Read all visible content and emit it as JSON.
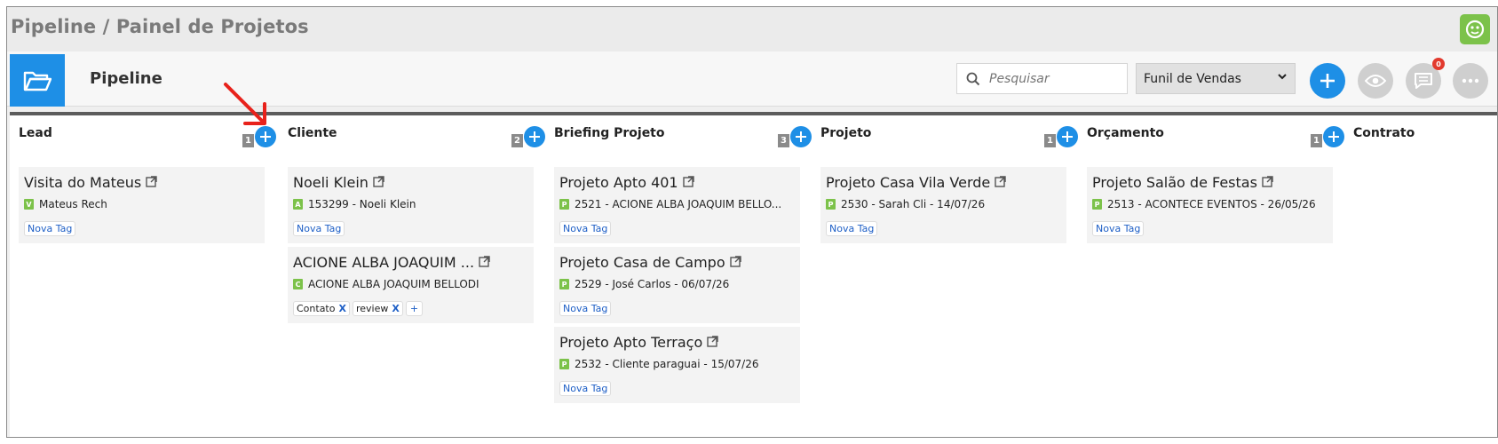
{
  "app": {
    "title": "Pipeline / Painel de Projetos",
    "logo_icon": "green-face-icon"
  },
  "header": {
    "page_title": "Pipeline",
    "folder_icon": "folder-open-icon",
    "search_placeholder": "Pesquisar",
    "funnel_select": "Funil de Vendas",
    "notifications_count": "0"
  },
  "columns": [
    {
      "name": "Lead",
      "count": "1",
      "cards": [
        {
          "title": "Visita do Mateus",
          "badge": "V",
          "subtitle": "Mateus Rech",
          "tags": [],
          "new_tag": "Nova Tag"
        }
      ]
    },
    {
      "name": "Cliente",
      "count": "2",
      "cards": [
        {
          "title": "Noeli Klein",
          "badge": "A",
          "subtitle": "153299 - Noeli Klein",
          "tags": [],
          "new_tag": "Nova Tag"
        },
        {
          "title": "ACIONE ALBA JOAQUIM ...",
          "badge": "C",
          "subtitle": "ACIONE ALBA JOAQUIM BELLODI",
          "tags": [
            "Contato",
            "review"
          ],
          "tag_remove": "X",
          "add_tag": "+"
        }
      ]
    },
    {
      "name": "Briefing Projeto",
      "count": "3",
      "cards": [
        {
          "title": "Projeto Apto 401",
          "badge": "P",
          "subtitle": "2521 - ACIONE ALBA JOAQUIM BELLO...",
          "tags": [],
          "new_tag": "Nova Tag"
        },
        {
          "title": "Projeto Casa de Campo",
          "badge": "P",
          "subtitle": "2529 - José Carlos - 06/07/26",
          "tags": [],
          "new_tag": "Nova Tag"
        },
        {
          "title": "Projeto Apto Terraço",
          "badge": "P",
          "subtitle": "2532 - Cliente paraguai - 15/07/26",
          "tags": [],
          "new_tag": "Nova Tag"
        }
      ]
    },
    {
      "name": "Projeto",
      "count": "1",
      "cards": [
        {
          "title": "Projeto Casa Vila Verde",
          "badge": "P",
          "subtitle": "2530 - Sarah Cli - 14/07/26",
          "tags": [],
          "new_tag": "Nova Tag"
        }
      ]
    },
    {
      "name": "Orçamento",
      "count": "1",
      "cards": [
        {
          "title": "Projeto Salão de Festas",
          "badge": "P",
          "subtitle": "2513 - ACONTECE EVENTOS - 26/05/26",
          "tags": [],
          "new_tag": "Nova Tag"
        }
      ]
    },
    {
      "name": "Contrato",
      "count": "",
      "cards": []
    }
  ],
  "colors": {
    "accent": "#1e8fe6",
    "badge_green": "#7cc24a",
    "column_border": "#5c5c5c",
    "annotation_arrow": "#e8221b"
  }
}
